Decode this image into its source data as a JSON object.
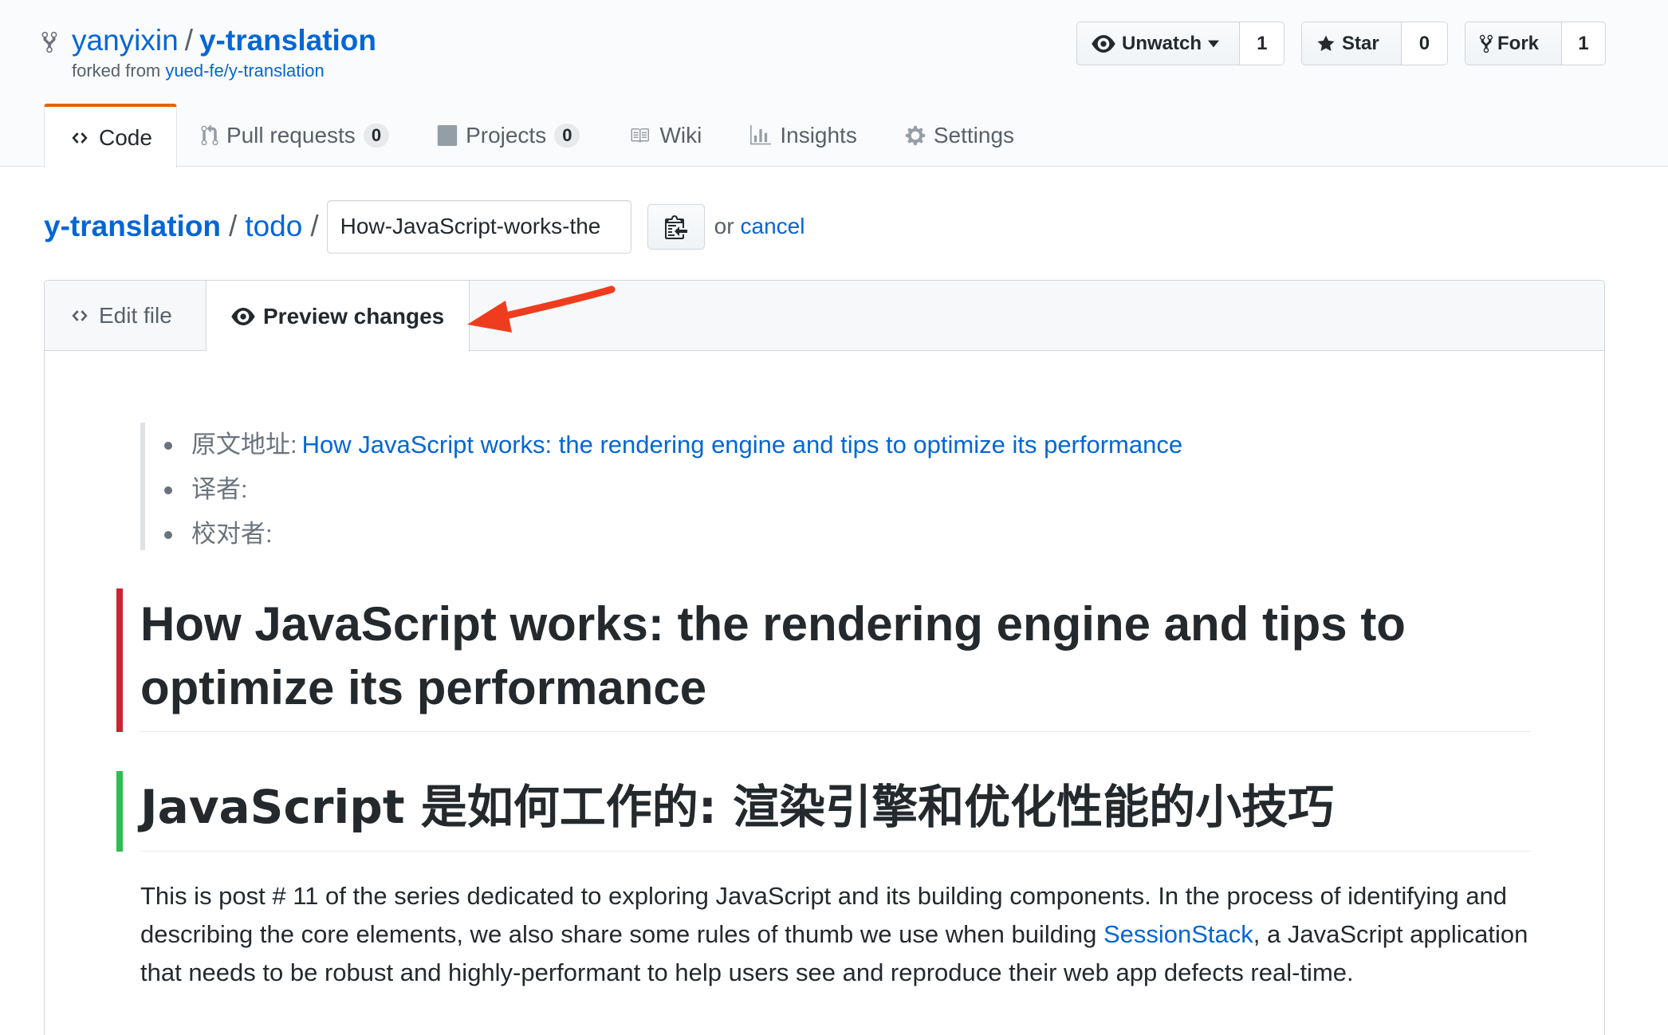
{
  "repo": {
    "owner": "yanyixin",
    "name": "y-translation",
    "forked_from_prefix": "forked from",
    "forked_from": "yued-fe/y-translation"
  },
  "social": {
    "watch": {
      "label": "Unwatch",
      "count": "1"
    },
    "star": {
      "label": "Star",
      "count": "0"
    },
    "fork": {
      "label": "Fork",
      "count": "1"
    }
  },
  "nav_tabs": [
    {
      "label": "Code",
      "icon": "code-icon",
      "selected": true
    },
    {
      "label": "Pull requests",
      "icon": "pull-request-icon",
      "counter": "0"
    },
    {
      "label": "Projects",
      "icon": "project-icon",
      "counter": "0"
    },
    {
      "label": "Wiki",
      "icon": "book-icon"
    },
    {
      "label": "Insights",
      "icon": "graph-icon"
    },
    {
      "label": "Settings",
      "icon": "gear-icon"
    }
  ],
  "breadcrumb": {
    "root": "y-translation",
    "folder": "todo",
    "separator": "/",
    "filename_value": "How-JavaScript-works-the",
    "or_text": "or",
    "cancel_label": "cancel"
  },
  "editor_tabs": {
    "edit_label": "Edit file",
    "preview_label": "Preview changes"
  },
  "preview": {
    "meta": [
      {
        "label": "原文地址:",
        "link": "How JavaScript works: the rendering engine and tips to optimize its performance"
      },
      {
        "label": "译者:",
        "link": ""
      },
      {
        "label": "校对者:",
        "link": ""
      }
    ],
    "heading_en": "How JavaScript works: the rendering engine and tips to optimize its performance",
    "heading_zh": "JavaScript 是如何工作的: 渲染引擎和优化性能的小技巧",
    "para_before_link": "This is post # 11 of the series dedicated to exploring JavaScript and its building components. In the process of identifying and describing the core elements, we also share some rules of thumb we use when building ",
    "para_link": "SessionStack",
    "para_after_link": ", a JavaScript application that needs to be robust and highly-performant to help users see and reproduce their web app defects real-time."
  },
  "colors": {
    "link": "#0366d6",
    "removed_bar": "#cb2431",
    "added_bar": "#2cbe4e",
    "selected_tab_accent": "#e36209",
    "annotation_arrow": "#f03c1e"
  }
}
